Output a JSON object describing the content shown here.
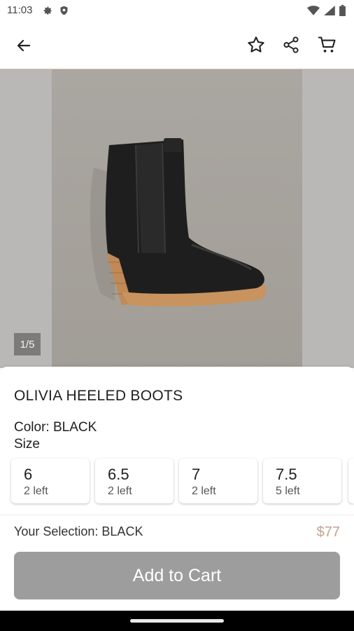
{
  "status_bar": {
    "time": "11:03",
    "left_icons": [
      "gear-icon",
      "shield-icon"
    ],
    "right_icons": [
      "wifi-icon",
      "signal-icon",
      "battery-icon"
    ]
  },
  "app_bar": {
    "icons": [
      "back-arrow-icon",
      "star-icon",
      "share-icon",
      "cart-icon"
    ]
  },
  "gallery": {
    "counter": "1/5",
    "colors": {
      "backdrop": "#b9b8b6",
      "photo": "#a8a49f",
      "boot": "#1e1e1e",
      "heel": "#c08a57"
    }
  },
  "product": {
    "title": "OLIVIA HEELED BOOTS",
    "color_line": "Color: BLACK",
    "size_heading": "Size",
    "sizes": [
      {
        "size": "6",
        "stock": "2 left"
      },
      {
        "size": "6.5",
        "stock": "2 left"
      },
      {
        "size": "7",
        "stock": "2 left"
      },
      {
        "size": "7.5",
        "stock": "5 left"
      }
    ],
    "selection": "Your Selection: BLACK",
    "price": "$77",
    "cta": "Add to Cart"
  },
  "theme": {
    "price_color": "#c3a391",
    "button_color": "#9d9d9d",
    "app_bar_border": "#d7b9a8"
  }
}
